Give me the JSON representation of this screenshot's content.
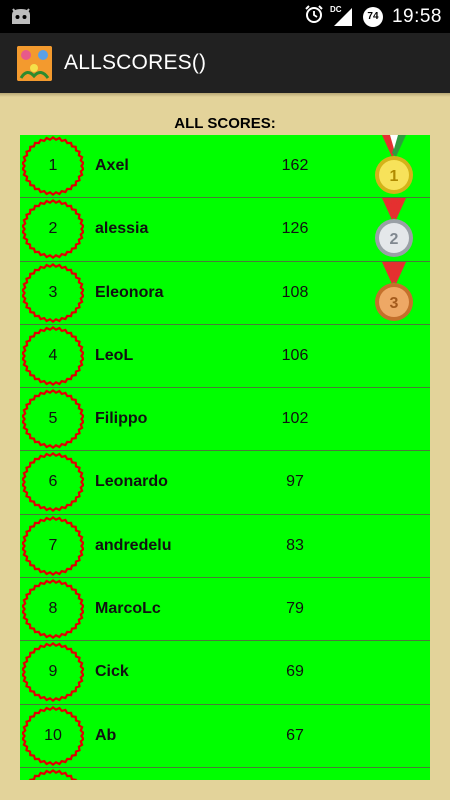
{
  "status_bar": {
    "time": "19:58",
    "network_label": "DC",
    "battery_level": "74",
    "icons": [
      "android-debug-icon",
      "alarm-icon",
      "signal-icon",
      "battery-icon"
    ]
  },
  "action_bar": {
    "title": "ALLSCORES()",
    "app_icon": "app-flowers-icon"
  },
  "heading": "ALL SCORES:",
  "colors": {
    "background": "#e3d39a",
    "list_background": "#00ff00",
    "rank_circle": "#e00000",
    "action_bar": "#212121"
  },
  "scores": [
    {
      "rank": "1",
      "name": "Axel",
      "score": "162",
      "medal": "gold-medal-icon"
    },
    {
      "rank": "2",
      "name": "alessia",
      "score": "126",
      "medal": "silver-medal-icon"
    },
    {
      "rank": "3",
      "name": "Eleonora",
      "score": "108",
      "medal": "bronze-medal-icon"
    },
    {
      "rank": "4",
      "name": "LeoL",
      "score": "106",
      "medal": ""
    },
    {
      "rank": "5",
      "name": "Filippo",
      "score": "102",
      "medal": ""
    },
    {
      "rank": "6",
      "name": "Leonardo",
      "score": "97",
      "medal": ""
    },
    {
      "rank": "7",
      "name": "andredelu",
      "score": "83",
      "medal": ""
    },
    {
      "rank": "8",
      "name": "MarcoLc",
      "score": "79",
      "medal": ""
    },
    {
      "rank": "9",
      "name": "Cick",
      "score": "69",
      "medal": ""
    },
    {
      "rank": "10",
      "name": "Ab",
      "score": "67",
      "medal": ""
    },
    {
      "rank": "",
      "name": "",
      "score": "",
      "medal": ""
    }
  ]
}
